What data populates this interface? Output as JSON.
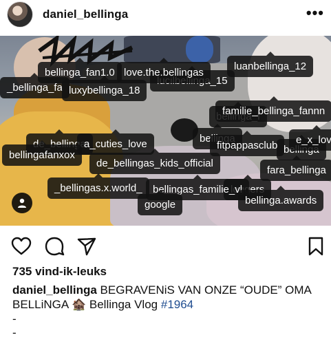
{
  "header": {
    "username": "daniel_bellinga",
    "more_icon": "more-horizontal-icon"
  },
  "photo": {
    "tags": [
      "bellinga_fan1.0",
      "love.the.bellingas",
      "luanbellinga_12",
      "_bellinga_fa",
      "luxybellinga_18",
      "lucilbellinga_15",
      "familie_bellinga_fannn",
      "bellinga_f",
      "de_bellinga",
      "a_cuties_love",
      "bellinga",
      "fitpappasclub",
      "e_x_love",
      "bellinga",
      "bellingafanxox",
      "de_bellingas_kids_official",
      "fara_bellinga",
      "_bellingas.x.world_",
      "bellingas_familie_vl",
      "loggers",
      "google",
      "bellinga.awards"
    ],
    "people_icon": "user-tag-icon"
  },
  "actions": {
    "like_icon": "heart-icon",
    "comment_icon": "comment-icon",
    "share_icon": "send-icon",
    "save_icon": "bookmark-icon"
  },
  "likes": "735 vind-ik-leuks",
  "caption": {
    "username": "daniel_bellinga",
    "text": "BEGRAVENiS VAN ONZE “OUDE” OMA BELLiNGA 🏚️ Bellinga Vlog",
    "hashtag": "#1964",
    "lines": [
      "-",
      "-"
    ]
  }
}
